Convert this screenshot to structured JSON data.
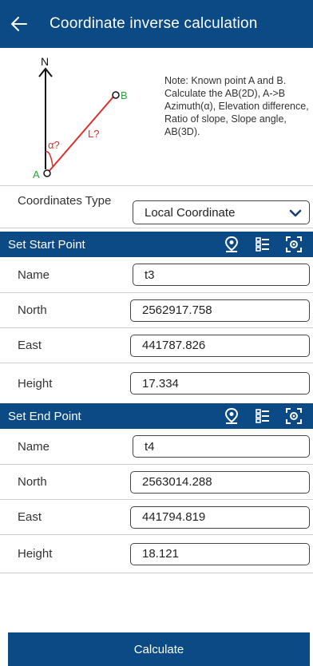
{
  "header": {
    "title": "Coordinate inverse calculation",
    "back_icon": "arrow-left-icon"
  },
  "diagram": {
    "north_label": "N",
    "point_a": "A",
    "point_b": "B",
    "angle_label": "α?",
    "length_label": "L?",
    "note": "Note: Known point A and B. Calculate the AB(2D), A->B Azimuth(α), Elevation difference, Ratio of slope, Slope angle, AB(3D)."
  },
  "coordinates_type": {
    "label": "Coordinates Type",
    "value": "Local Coordinate"
  },
  "start_point": {
    "title": "Set Start Point",
    "icons": [
      "location-pin-icon",
      "list-icon",
      "scan-icon"
    ],
    "name_label": "Name",
    "name": "t3",
    "north_label": "North",
    "north": "2562917.758",
    "east_label": "East",
    "east": "441787.826",
    "height_label": "Height",
    "height": "17.334"
  },
  "end_point": {
    "title": "Set End Point",
    "icons": [
      "location-pin-icon",
      "list-icon",
      "scan-icon"
    ],
    "name_label": "Name",
    "name": "t4",
    "north_label": "North",
    "north": "2563014.288",
    "east_label": "East",
    "east": "441794.819",
    "height_label": "Height",
    "height": "18.121"
  },
  "calculate_label": "Calculate",
  "colors": {
    "primary": "#0b4a85",
    "line_red": "#d9302c",
    "point_green": "#2aa43a"
  }
}
